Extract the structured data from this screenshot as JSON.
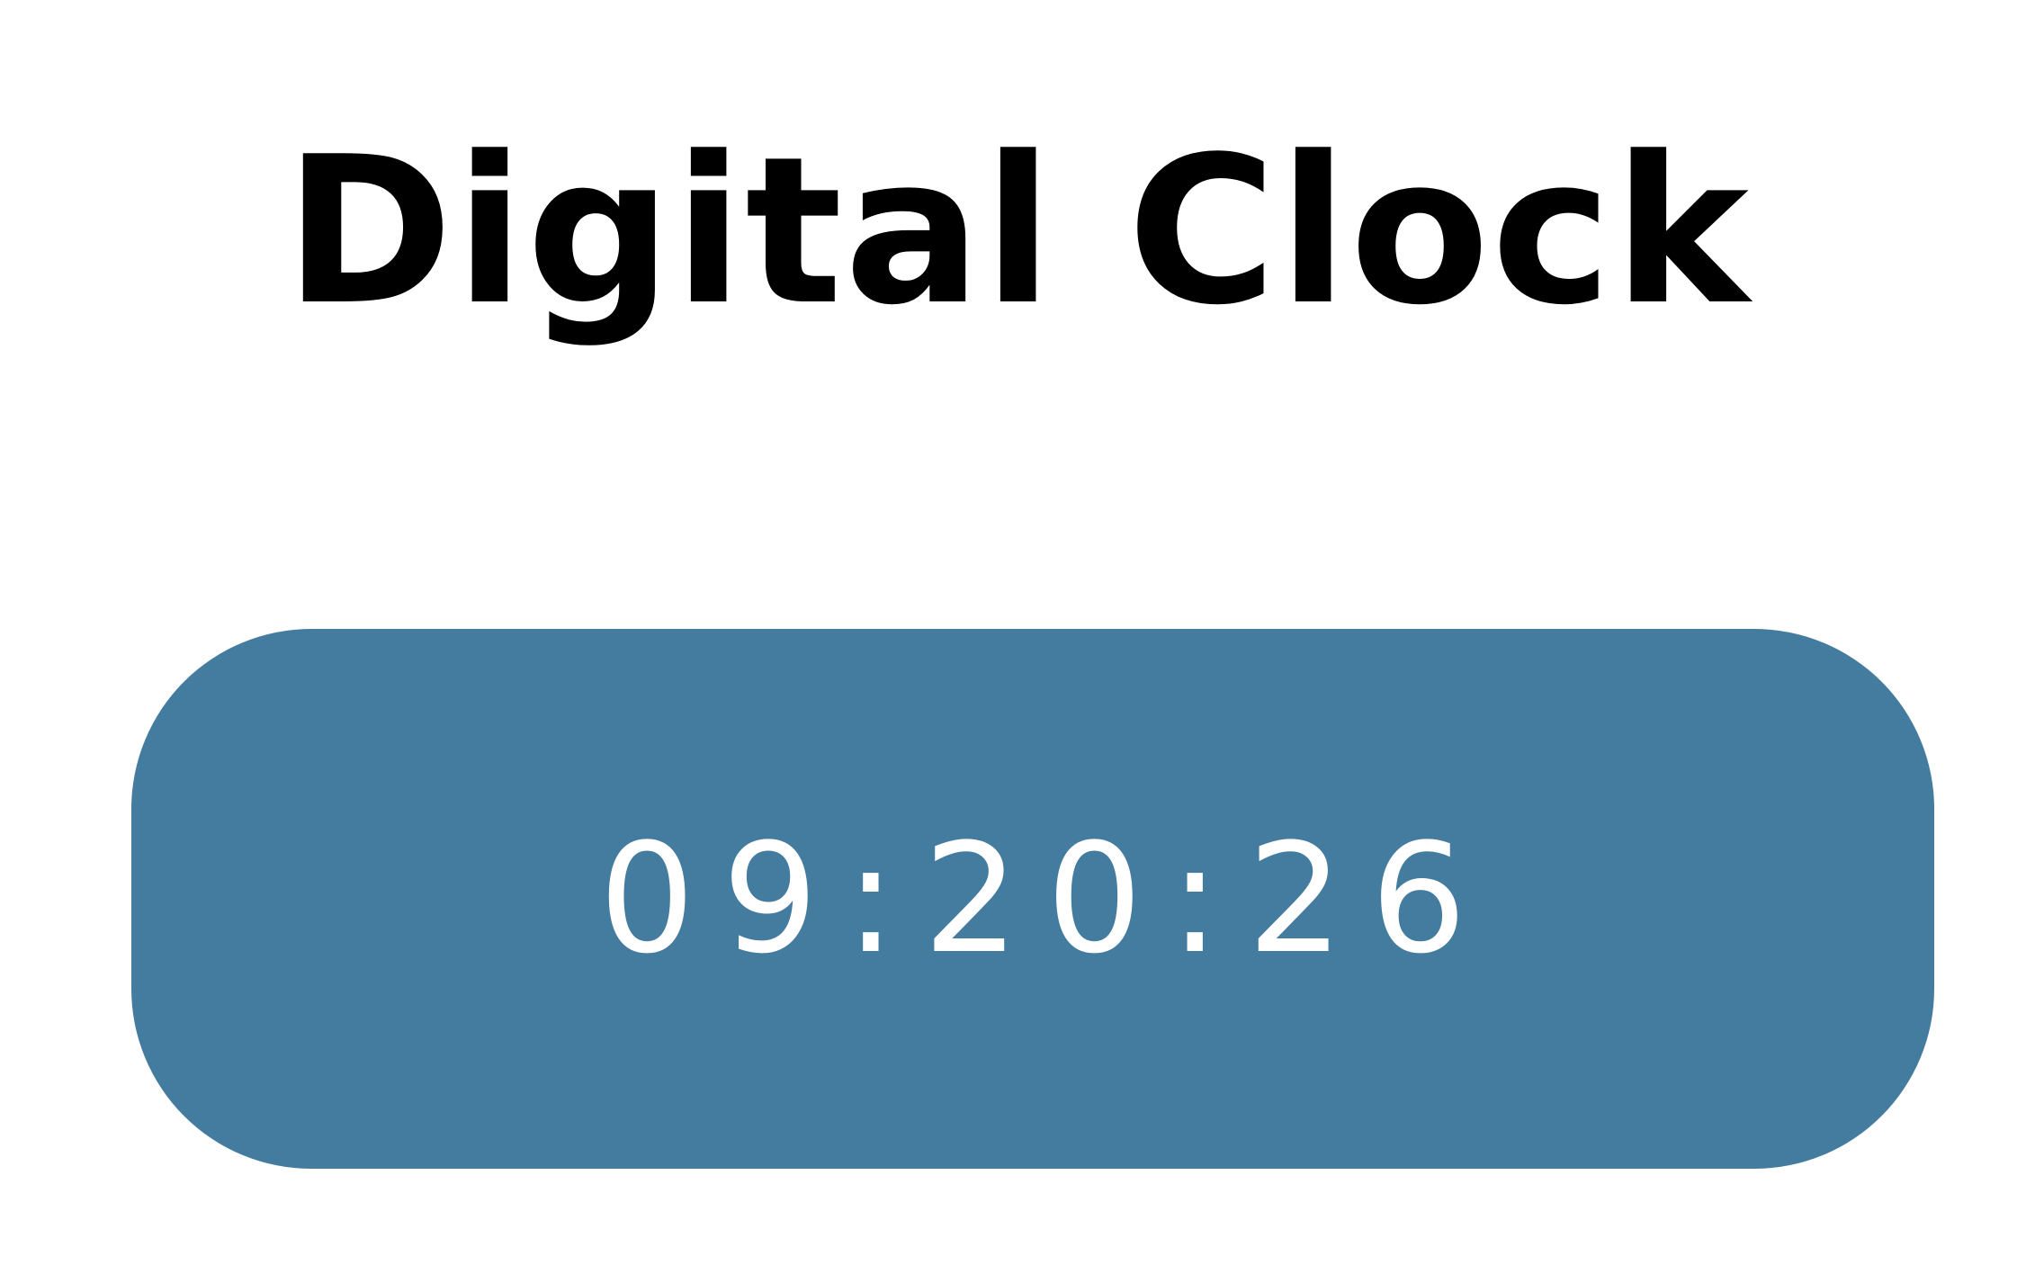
{
  "header": {
    "title": "Digital Clock"
  },
  "clock": {
    "time": "09:20:26",
    "panel_color": "#447c9f",
    "text_color": "#ffffff"
  }
}
